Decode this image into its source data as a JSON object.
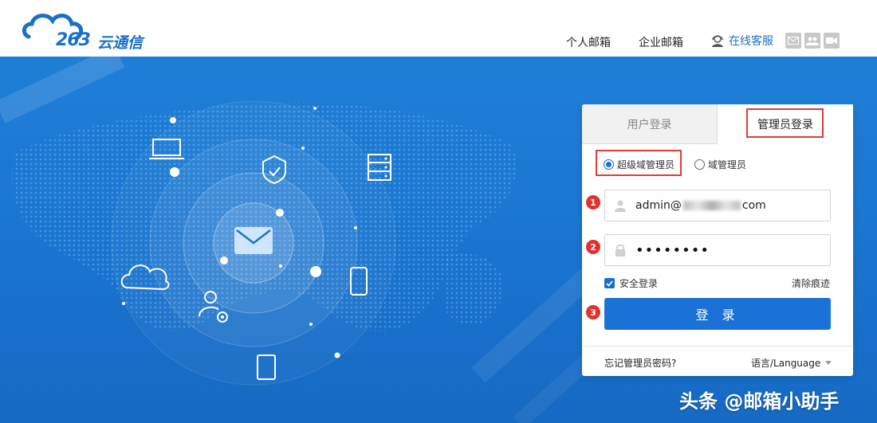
{
  "header": {
    "logo_number": "263",
    "logo_text": "云通信",
    "nav": {
      "personal": "个人邮箱",
      "enterprise": "企业邮箱"
    },
    "support": "在线客服",
    "icons": [
      "mail-icon",
      "group-icon",
      "video-icon"
    ]
  },
  "login": {
    "tabs": {
      "user": "用户登录",
      "admin": "管理员登录",
      "active": "admin"
    },
    "roles": {
      "super": "超级域管理员",
      "domain": "域管理员",
      "selected": "super"
    },
    "steps": [
      "1",
      "2",
      "3"
    ],
    "username": {
      "prefix": "admin@",
      "suffix": "com"
    },
    "password": "••••••••",
    "secure_label": "安全登录",
    "secure_checked": true,
    "clear_label": "清除痕迹",
    "submit": "登 录",
    "forgot": "忘记管理员密码?",
    "language": "语言/Language"
  },
  "watermark": "头条 @邮箱小助手",
  "colors": {
    "brand": "#1a6fc9",
    "banner": "#1a74cf",
    "highlight": "#e33a3a",
    "step": "#e0322f"
  }
}
